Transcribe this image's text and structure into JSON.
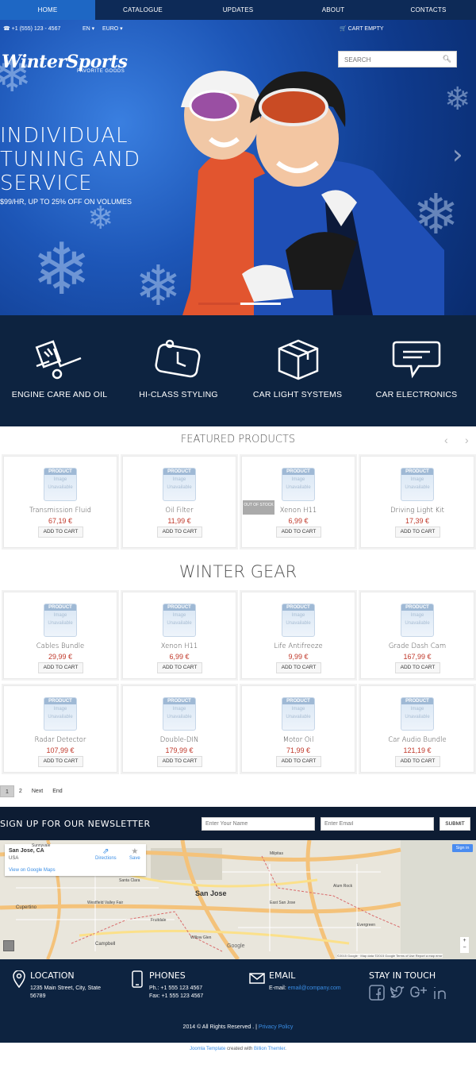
{
  "nav": {
    "items": [
      "HOME",
      "CATALOGUE",
      "UPDATES",
      "ABOUT",
      "CONTACTS"
    ]
  },
  "topbar": {
    "phone": "+1 (555) 123 - 4567",
    "language": "EN",
    "currency": "EURO",
    "cart": "CART EMPTY"
  },
  "brand": {
    "logo": "WinterSports",
    "tagline": "FAVORITE GOODS"
  },
  "search": {
    "placeholder": "SEARCH"
  },
  "hero": {
    "line1": "INDIVIDUAL",
    "line2": "TUNING AND",
    "line3": "SERVICE",
    "sub": "$99/HR, UP TO 25% OFF ON VOLUMES",
    "active_slide": 1,
    "slides": 2
  },
  "features": [
    {
      "label": "ENGINE CARE AND OIL",
      "icon": "dolly-icon"
    },
    {
      "label": "HI-CLASS STYLING",
      "icon": "clock-icon"
    },
    {
      "label": "CAR LIGHT SYSTEMS",
      "icon": "box-icon"
    },
    {
      "label": "CAR ELECTRONICS",
      "icon": "chat-icon"
    }
  ],
  "thumb": {
    "top": "PRODUCT",
    "l1": "Image",
    "l2": "Unavailable"
  },
  "featured": {
    "title": "FEATURED PRODUCTS",
    "products": [
      {
        "name": "Transmission Fluid",
        "price": "67,19 €"
      },
      {
        "name": "Oil Filter",
        "price": "11,99 €"
      },
      {
        "name": "Xenon H11",
        "price": "6,99 €",
        "badge": "OUT OF STOCK"
      },
      {
        "name": "Driving Light Kit",
        "price": "17,39 €"
      }
    ]
  },
  "winter": {
    "title": "WINTER GEAR",
    "products": [
      {
        "name": "Cables Bundle",
        "price": "29,99 €"
      },
      {
        "name": "Xenon H11",
        "price": "6,99 €"
      },
      {
        "name": "Life Antifreeze",
        "price": "9,99 €"
      },
      {
        "name": "Grade Dash Cam",
        "price": "167,99 €"
      },
      {
        "name": "Radar Detector",
        "price": "107,99 €"
      },
      {
        "name": "Double-DIN",
        "price": "179,99 €"
      },
      {
        "name": "Motor Oil",
        "price": "71,99 €"
      },
      {
        "name": "Car Audio Bundle",
        "price": "121,19 €"
      }
    ]
  },
  "add_to_cart": "ADD TO CART",
  "pager": {
    "current": "1",
    "page2": "2",
    "next": "Next",
    "end": "End"
  },
  "newsletter": {
    "title": "SIGN UP FOR OUR NEWSLETTER",
    "name_placeholder": "Enter Your Name",
    "email_placeholder": "Enter Email",
    "submit": "SUBMIT"
  },
  "map": {
    "place": "San Jose, CA",
    "country": "USA",
    "directions": "Directions",
    "save": "Save",
    "view_link": "View on Google Maps",
    "sign_in": "Sign in",
    "city_label": "San Jose",
    "labels": [
      "Cupertino",
      "Westfield Valley Fair",
      "Campbell",
      "Fruitdale",
      "Milpitas",
      "Alum Rock",
      "Evergreen",
      "Sunnyvale",
      "Santa Clara",
      "Willow Glen",
      "East San Jose"
    ],
    "attribution": "©2015 Google · Map data ©2015 Google   Terms of Use   Report a map error",
    "google": "Google"
  },
  "footer": {
    "location": {
      "title": "LOCATION",
      "line1": "1235 Main Street, City, State",
      "line2": "56789"
    },
    "phones": {
      "title": "PHONES",
      "line1": "Ph.: +1 555 123 4567",
      "line2": "Fax: +1 555 123 4567"
    },
    "email": {
      "title": "EMAIL",
      "prefix": "E-mail: ",
      "address": "email@company.com"
    },
    "social": {
      "title": "STAY IN TOUCH"
    },
    "copyright": "2014 © All Rights Reserved . |",
    "privacy": "Privacy Policy"
  },
  "credits": {
    "a": "Joomla Template",
    "b": " created with ",
    "c": "Billion Themler",
    "d": "."
  }
}
